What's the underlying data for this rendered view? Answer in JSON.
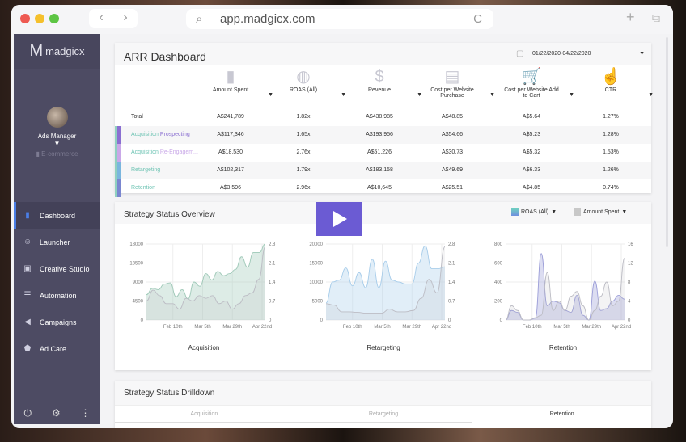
{
  "browser": {
    "url": "app.madgicx.com",
    "back": "‹",
    "forward": "›",
    "search_icon": "search-icon",
    "reload": "C",
    "new_tab": "+",
    "tabs_icon": "⧉"
  },
  "sidebar": {
    "brand": "madgicx",
    "account": "Ads Manager",
    "account_type": "E-commerce",
    "items": [
      {
        "label": "Dashboard",
        "icon": "bar-chart-icon",
        "active": true
      },
      {
        "label": "Launcher",
        "icon": "rocket-icon"
      },
      {
        "label": "Creative Studio",
        "icon": "image-icon"
      },
      {
        "label": "Automation",
        "icon": "sliders-icon"
      },
      {
        "label": "Campaigns",
        "icon": "megaphone-icon"
      },
      {
        "label": "Ad Care",
        "icon": "shield-icon"
      }
    ],
    "footer": [
      "power-icon",
      "gear-icon",
      "more-icon"
    ]
  },
  "arr": {
    "title": "ARR Dashboard",
    "date_range": "01/22/2020-04/22/2020",
    "columns": [
      {
        "label": "Amount Spent",
        "icon": "bar-chart-icon"
      },
      {
        "label": "ROAS (All)",
        "icon": "globe-icon"
      },
      {
        "label": "Revenue",
        "icon": "dollar-icon"
      },
      {
        "label": "Cost per Website Purchase",
        "icon": "presentation-icon"
      },
      {
        "label": "Cost per Website Add to Cart",
        "icon": "cart-icon"
      },
      {
        "label": "CTR",
        "icon": "hand-pointer-icon"
      }
    ],
    "rows": [
      {
        "name1": "Total",
        "name2": "",
        "values": [
          "A$241,789",
          "1.82x",
          "A$438,985",
          "A$48.85",
          "A$5.64",
          "1.27%"
        ],
        "color": ""
      },
      {
        "name1": "Acquisition",
        "name2": "Prospecting",
        "values": [
          "A$117,346",
          "1.65x",
          "A$193,956",
          "A$54.66",
          "A$5.23",
          "1.28%"
        ],
        "color": "#8a6fd1"
      },
      {
        "name1": "Acquisition",
        "name2": "Re-Engagem...",
        "values": [
          "A$18,530",
          "2.76x",
          "A$51,226",
          "A$30.73",
          "A$5.32",
          "1.53%"
        ],
        "color": "#c9a8e8"
      },
      {
        "name1": "Retargeting",
        "name2": "",
        "values": [
          "A$102,317",
          "1.79x",
          "A$183,158",
          "A$49.69",
          "A$6.33",
          "1.26%"
        ],
        "color": "#7ab6de"
      },
      {
        "name1": "Retention",
        "name2": "",
        "values": [
          "A$3,596",
          "2.96x",
          "A$10,645",
          "A$25.51",
          "A$4.85",
          "0.74%"
        ],
        "color": "#7a86d0"
      }
    ]
  },
  "overview": {
    "title": "Strategy Status Overview",
    "legend": [
      {
        "label": "ROAS (All)",
        "color": "#6fa8dc"
      },
      {
        "label": "Amount Spent",
        "color": "#c8c8c8"
      }
    ]
  },
  "chart_data": [
    {
      "type": "area",
      "title": "Acquisition",
      "x_ticks": [
        "Feb 10th",
        "Mar 5th",
        "Mar 29th",
        "Apr 22nd"
      ],
      "y_left_ticks": [
        "0",
        "4500",
        "9000",
        "13500",
        "18000"
      ],
      "y_right_ticks": [
        "0",
        "0.7",
        "1.4",
        "2.1",
        "2.8"
      ],
      "ylim_left": [
        0,
        18000
      ],
      "ylim_right": [
        0,
        2.8
      ],
      "color": "#9fc9b8",
      "series": [
        {
          "axis": "left",
          "values": [
            6000,
            7500,
            7200,
            8500,
            8800,
            5500,
            7200,
            5000,
            9000,
            8000,
            11000,
            9500,
            11500,
            10500,
            11000,
            12000,
            15000,
            12500,
            16000,
            16000,
            18000
          ]
        },
        {
          "axis": "right",
          "values": [
            0.7,
            1.1,
            0.9,
            0.6,
            0.6,
            0.4,
            0.8,
            0.7,
            0.9,
            0.8,
            0.9,
            0.6,
            0.7,
            0.4,
            0.6,
            0.9,
            1.0,
            1.5,
            2.7
          ]
        }
      ]
    },
    {
      "type": "area",
      "title": "Retargeting",
      "x_ticks": [
        "Feb 10th",
        "Mar 5th",
        "Mar 29th",
        "Apr 22nd"
      ],
      "y_left_ticks": [
        "0",
        "5000",
        "10000",
        "15000",
        "20000"
      ],
      "y_right_ticks": [
        "0",
        "0.7",
        "1.4",
        "2.1",
        "2.8"
      ],
      "ylim_left": [
        0,
        20000
      ],
      "ylim_right": [
        0,
        2.8
      ],
      "color": "#a8cdea",
      "series": [
        {
          "axis": "left",
          "values": [
            4500,
            10000,
            10500,
            13700,
            9000,
            12500,
            8500,
            16000,
            8500,
            15500,
            10500,
            10000,
            9500,
            9500,
            15000,
            19500,
            13500,
            13500,
            14000
          ]
        },
        {
          "axis": "right",
          "values": [
            0.6,
            0.55,
            0.3,
            0.3,
            0.28,
            0.25,
            0.25,
            0.25,
            0.4,
            0.3,
            0.3,
            0.35,
            0.8,
            1.5,
            1.0,
            2.7
          ]
        }
      ]
    },
    {
      "type": "area",
      "title": "Retention",
      "x_ticks": [
        "Feb 10th",
        "Mar 5th",
        "Mar 29th",
        "Apr 22nd"
      ],
      "y_left_ticks": [
        "0",
        "200",
        "400",
        "600",
        "800"
      ],
      "y_right_ticks": [
        "0",
        "4",
        "8",
        "12",
        "16"
      ],
      "ylim_left": [
        0,
        800
      ],
      "ylim_right": [
        0,
        16
      ],
      "color": "#9c9ed8",
      "series": [
        {
          "axis": "left",
          "values": [
            0,
            100,
            80,
            0,
            0,
            20,
            700,
            150,
            200,
            180,
            100,
            80,
            260,
            50,
            0,
            410,
            100,
            120,
            200,
            260,
            220
          ]
        },
        {
          "axis": "right",
          "values": [
            0,
            3,
            2,
            0,
            0,
            0.5,
            1,
            10,
            2,
            4,
            2,
            5,
            6,
            3,
            0,
            2,
            5,
            8,
            3,
            4,
            13
          ]
        }
      ]
    }
  ],
  "drilldown": {
    "title": "Strategy Status Drilldown",
    "tabs": [
      "Acquisition",
      "Retargeting",
      "Retention"
    ],
    "active": "Retention"
  },
  "video": {
    "play_icon": "play-icon",
    "accent": "#6b5bd3"
  }
}
